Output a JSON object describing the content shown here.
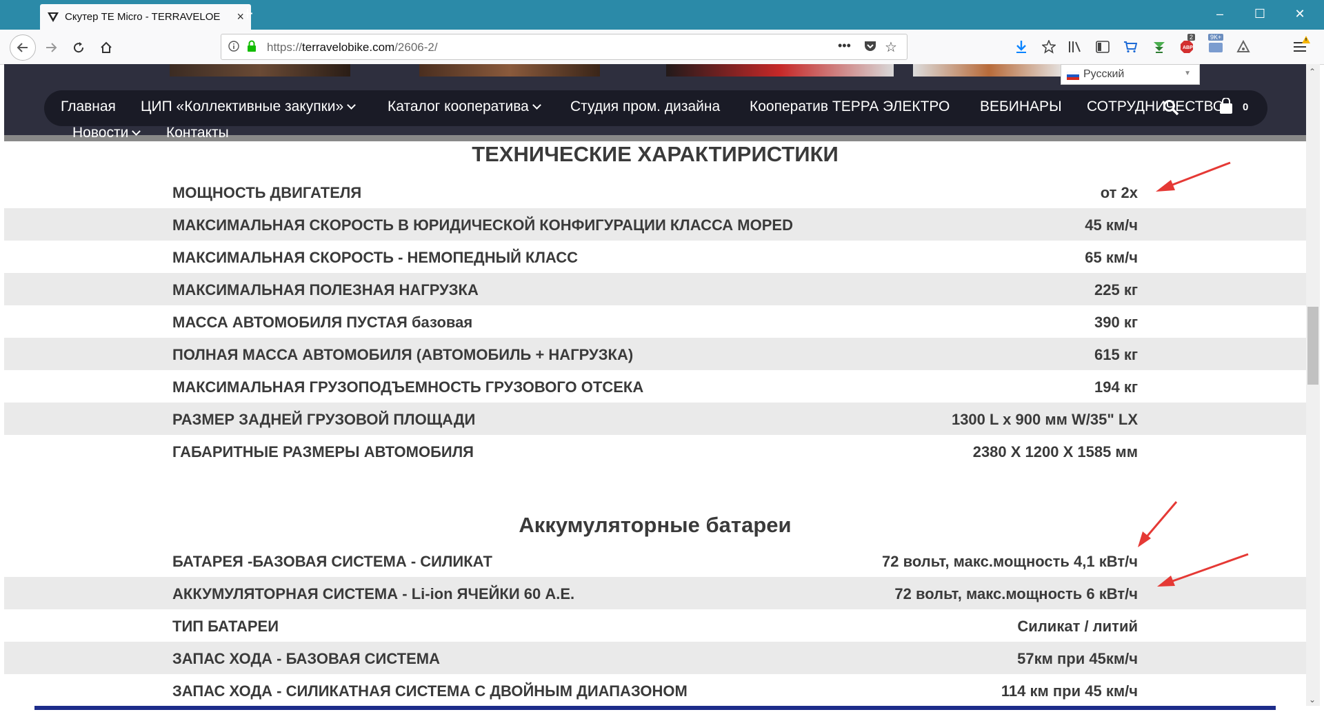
{
  "browser": {
    "tab_title": "Скутер TE Micro - TERRAVELOE",
    "new_tab": "+",
    "url_prefix": "https://",
    "url_domain": "terravelobike.com",
    "url_path": "/2606-2/",
    "page_actions": "•••",
    "badge_abp": "2",
    "badge_count": "9K+"
  },
  "site": {
    "language": "Русский",
    "menu": {
      "home": "Главная",
      "cip": "ЦИП «Коллективные закупки»",
      "catalog": "Каталог кооператива",
      "studio": "Студия пром. дизайна",
      "coop": "Кооператив ТЕРРА ЭЛЕКТРО",
      "webinars": "ВЕБИНАРЫ",
      "cooperation": "СОТРУДНИЧЕСТВО",
      "news": "Новости",
      "contacts": "Контакты",
      "cart_count": "0"
    }
  },
  "specs": {
    "title": "ТЕХНИЧЕСКИЕ ХАРАКТИРИСТИКИ",
    "rows": [
      {
        "label": "МОЩНОСТЬ ДВИГАТЕЛЯ",
        "value": "от 2х"
      },
      {
        "label": "МАКСИМАЛЬНАЯ СКОРОСТЬ В ЮРИДИЧЕСКОЙ КОНФИГУРАЦИИ КЛАССА MOPED",
        "value": "45 км/ч"
      },
      {
        "label": "МАКСИМАЛЬНАЯ СКОРОСТЬ - НЕМОПЕДНЫЙ КЛАСС",
        "value": "65 км/ч"
      },
      {
        "label": "МАКСИМАЛЬНАЯ ПОЛЕЗНАЯ НАГРУЗКА",
        "value": "225 кг"
      },
      {
        "label": "МАССА АВТОМОБИЛЯ ПУСТАЯ базовая",
        "value": "390 кг"
      },
      {
        "label": "ПОЛНАЯ МАССА АВТОМОБИЛЯ (АВТОМОБИЛЬ + НАГРУЗКА)",
        "value": "615 кг"
      },
      {
        "label": "МАКСИМАЛЬНАЯ ГРУЗОПОДЪЕМНОСТЬ ГРУЗОВОГО ОТСЕКА",
        "value": "194 кг"
      },
      {
        "label": "РАЗМЕР ЗАДНЕЙ ГРУЗОВОЙ ПЛОЩАДИ",
        "value": "1300 L x 900 мм W/35\" LX"
      },
      {
        "label": "ГАБАРИТНЫЕ РАЗМЕРЫ АВТОМОБИЛЯ",
        "value": "2380 X 1200 X 1585 мм"
      }
    ]
  },
  "battery": {
    "title": "Аккумуляторные батареи",
    "rows": [
      {
        "label": "БАТАРЕЯ -БАЗОВАЯ СИСТЕМА - СИЛИКАТ",
        "value": "72 вольт, макс.мощность 4,1 кВт/ч"
      },
      {
        "label": "АККУМУЛЯТОРНАЯ СИСТЕМА - Li-ion ЯЧЕЙКИ 60 А.Е.",
        "value": "72 вольт, макс.мощность 6 кВт/ч"
      },
      {
        "label": "ТИП БАТАРЕИ",
        "value": "Силикат / литий"
      },
      {
        "label": "ЗАПАС ХОДА - БАЗОВАЯ СИСТЕМА",
        "value": "57км при 45км/ч"
      },
      {
        "label": "ЗАПАС ХОДА - СИЛИКАТНАЯ СИСТЕМА С ДВОЙНЫМ ДИАПАЗОНОМ",
        "value": "114 км при 45 км/ч"
      }
    ]
  },
  "colors": {
    "titlebar": "#2b8aa8",
    "menu_bg": "#1a1b26",
    "annotation_arrow": "#e53935"
  }
}
